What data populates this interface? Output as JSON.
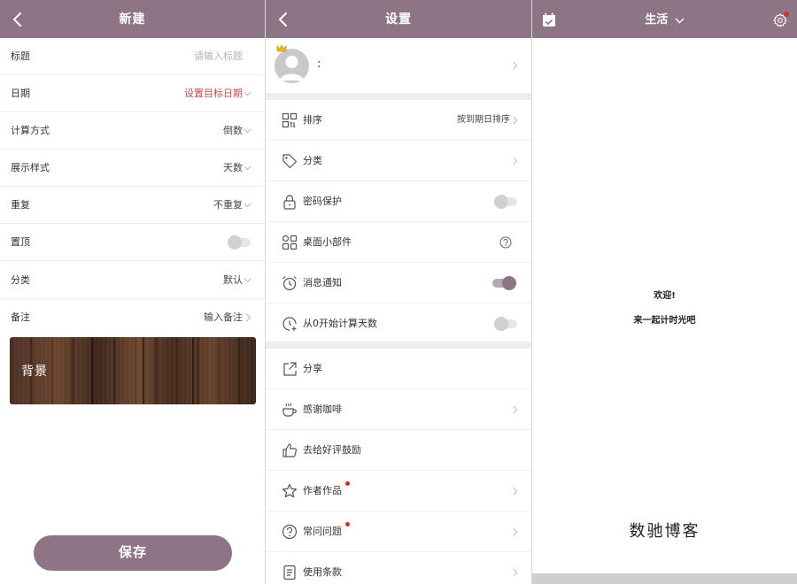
{
  "new_screen": {
    "title": "新建",
    "rows": [
      {
        "label": "标题",
        "value": "请输入标题"
      },
      {
        "label": "日期",
        "value": "设置目标日期"
      },
      {
        "label": "计算方式",
        "value": "倒数"
      },
      {
        "label": "展示样式",
        "value": "天数"
      },
      {
        "label": "重复",
        "value": "不重复"
      },
      {
        "label": "置顶",
        "value": ""
      },
      {
        "label": "分类",
        "value": "默认"
      },
      {
        "label": "备注",
        "value": "输入备注"
      }
    ],
    "pin_toggle": "off",
    "background_label": "背景",
    "save_label": "保存"
  },
  "settings_screen": {
    "title": "设置",
    "profile_name": ":",
    "items": [
      {
        "label": "排序",
        "value": "按到期日排序",
        "icon": "grid-sort-icon"
      },
      {
        "label": "分类",
        "value": "",
        "icon": "tag-icon"
      },
      {
        "label": "密码保护",
        "value": "",
        "icon": "lock-icon",
        "toggle": "off"
      },
      {
        "label": "桌面小部件",
        "value": "",
        "icon": "widgets-icon"
      },
      {
        "label": "消息通知",
        "value": "",
        "icon": "alarm-icon",
        "toggle": "on"
      },
      {
        "label": "从0开始计算天数",
        "value": "",
        "icon": "clock-plus-icon",
        "toggle": "off"
      },
      {
        "label": "分享",
        "value": "",
        "icon": "share-icon"
      },
      {
        "label": "感谢咖啡",
        "value": "",
        "icon": "coffee-icon"
      },
      {
        "label": "去给好评鼓励",
        "value": "",
        "icon": "thumbs-up-icon"
      },
      {
        "label": "作者作品",
        "value": "",
        "icon": "star-icon"
      },
      {
        "label": "常问问题",
        "value": "",
        "icon": "question-icon"
      },
      {
        "label": "使用条款",
        "value": "",
        "icon": "document-icon"
      }
    ]
  },
  "home_screen": {
    "title": "生活",
    "welcome": "欢迎!",
    "subtitle": "来一起计时光吧",
    "brand": "数驰博客"
  },
  "colors": {
    "accent": "#8e7585",
    "red_text": "#c44a4a",
    "badge": "#d8262c"
  }
}
